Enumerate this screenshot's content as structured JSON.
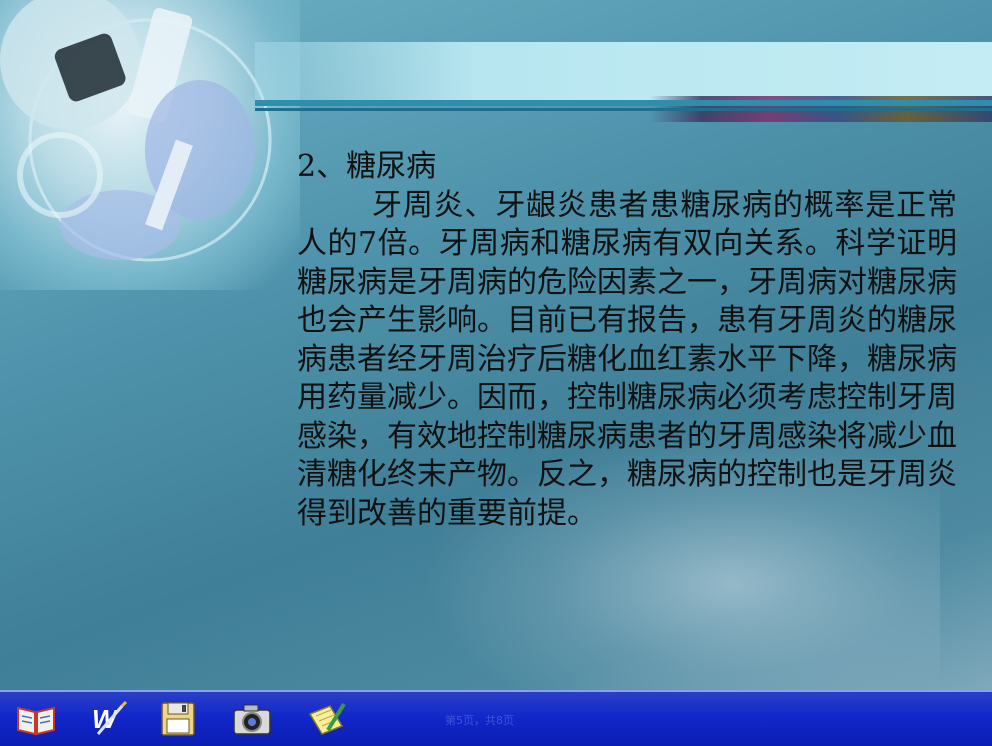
{
  "slide": {
    "heading": "2、糖尿病",
    "body": "牙周炎、牙龈炎患者患糖尿病的概率是正常人的7倍。牙周病和糖尿病有双向关系。科学证明糖尿病是牙周病的危险因素之一，牙周病对糖尿病也会产生影响。目前已有报告，患有牙周炎的糖尿病患者经牙周治疗后糖化血红素水平下降，糖尿病用药量减少。因而，控制糖尿病必须考虑控制牙周感染，有效地控制糖尿病患者的牙周感染将减少血清糖化终末产物。反之，糖尿病的控制也是牙周炎得到改善的重要前提。"
  },
  "toolbar": {
    "buttons": [
      {
        "icon": "open-book-icon"
      },
      {
        "icon": "word-document-icon"
      },
      {
        "icon": "floppy-disk-icon"
      },
      {
        "icon": "camera-icon"
      },
      {
        "icon": "notepad-pencil-icon"
      }
    ],
    "page_indicator": "第5页，共8页"
  },
  "colors": {
    "background": "#4e93ab",
    "toolbar": "#1026c8",
    "text": "#111111"
  }
}
